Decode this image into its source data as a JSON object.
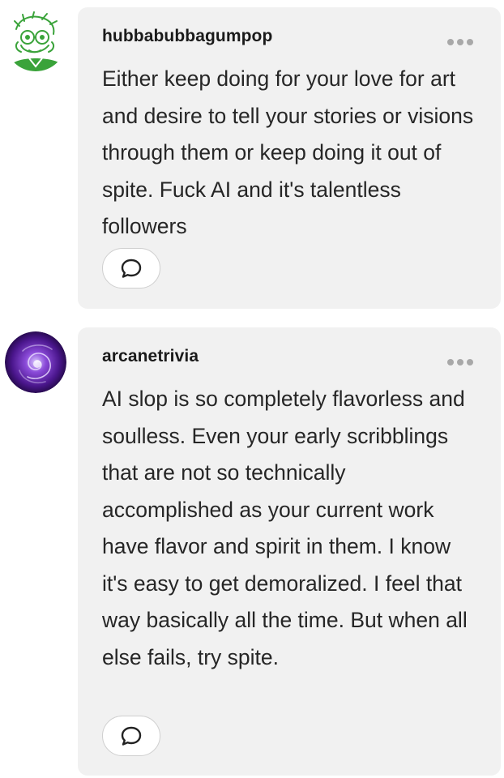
{
  "comments": [
    {
      "username": "hubbabubbagumpop",
      "body": "Either keep doing for your love for art and desire to tell your stories or visions through them or keep doing it out of spite. Fuck AI and it's talentless followers",
      "avatar_icon": "green-sketch-character-avatar",
      "reply_icon": "speech-bubble-icon",
      "more_icon": "ellipsis-icon"
    },
    {
      "username": "arcanetrivia",
      "body": "AI slop is so completely flavorless and soulless. Even your early scribblings that are not so technically accomplished as your current work have flavor and spirit in them. I know it's easy to get demoralized. I feel that way basically all the time. But when all else fails, try spite.",
      "avatar_icon": "purple-swirl-avatar",
      "reply_icon": "speech-bubble-icon",
      "more_icon": "ellipsis-icon"
    }
  ],
  "colors": {
    "bubble_background": "#f1f1f1",
    "text": "#262626",
    "muted_dots": "#a8a8a8",
    "avatar1_green": "#3aa33a",
    "avatar2_purple": "#5a1e9c"
  }
}
